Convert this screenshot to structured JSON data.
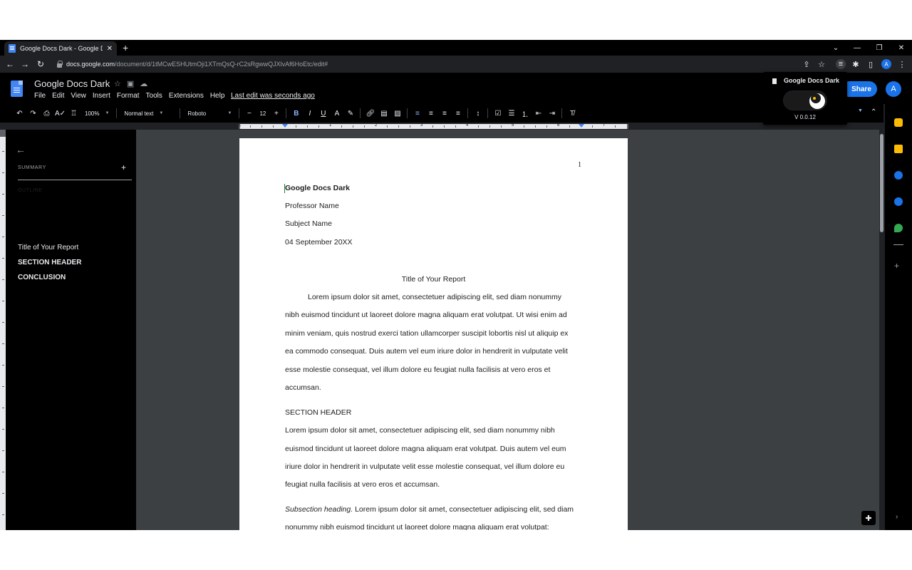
{
  "browser": {
    "tab_title": "Google Docs Dark - Google Docs",
    "tab_close": "✕",
    "new_tab": "+",
    "url_host": "docs.google.com",
    "url_path": "/document/d/1tMCwESHUtmOji1XTmQsQ-rC2sRgwwQJXlvAf6HoEtc/edit#",
    "profile_initial": "A"
  },
  "docs": {
    "title": "Google Docs Dark",
    "menu": [
      "File",
      "Edit",
      "View",
      "Insert",
      "Format",
      "Tools",
      "Extensions",
      "Help"
    ],
    "last_edit": "Last edit was seconds ago",
    "share_label": "Share",
    "account_initial": "A"
  },
  "toolbar": {
    "zoom": "100%",
    "style": "Normal text",
    "font": "Roboto",
    "font_size": "12"
  },
  "ruler": {
    "numbers": [
      "1",
      "1",
      "2",
      "3",
      "4",
      "5",
      "6",
      "7"
    ]
  },
  "outline": {
    "summary_label": "SUMMARY",
    "summary_add": "+",
    "outline_label": "OUTLINE",
    "items": [
      "Title of Your Report",
      "SECTION HEADER",
      "CONCLUSION"
    ]
  },
  "page": {
    "page_number": "1",
    "doc_heading": "Google Docs Dark",
    "professor": "Professor Name",
    "subject": "Subject Name",
    "date": "04 September 20XX",
    "report_title": "Title of Your Report",
    "para1": [
      "Lorem ipsum dolor sit amet, consectetuer adipiscing elit, sed diam nonummy",
      "nibh euismod tincidunt ut laoreet dolore magna aliquam erat volutpat. Ut wisi enim ad",
      "minim veniam, quis nostrud exerci tation ullamcorper suscipit lobortis nisl ut aliquip ex",
      "ea commodo consequat. Duis autem vel eum iriure dolor in hendrerit in vulputate velit",
      "esse molestie consequat, vel illum dolore eu feugiat nulla facilisis at vero eros et",
      "accumsan."
    ],
    "section_header": "SECTION HEADER",
    "para2": [
      "Lorem ipsum dolor sit amet, consectetuer adipiscing elit, sed diam nonummy nibh",
      "euismod tincidunt ut laoreet dolore magna aliquam erat volutpat. Duis autem vel eum",
      "iriure dolor in hendrerit in vulputate velit esse molestie consequat, vel illum dolore eu",
      "feugiat nulla facilisis at vero eros et accumsan."
    ],
    "subsection_heading": "Subsection heading.",
    "para3_line1": " Lorem ipsum dolor sit amet, consectetuer adipiscing elit, sed diam",
    "para3_line2": "nonummy nibh euismod tincidunt ut laoreet dolore magna aliquam erat volutpat:"
  },
  "extension_popup": {
    "title": "Google Docs Dark",
    "version": "V 0.0.12",
    "dark_mode_enabled": true
  },
  "colors": {
    "accent": "#1a73e8",
    "chrome_bg": "#000000",
    "canvas_bg": "#3c4043"
  }
}
